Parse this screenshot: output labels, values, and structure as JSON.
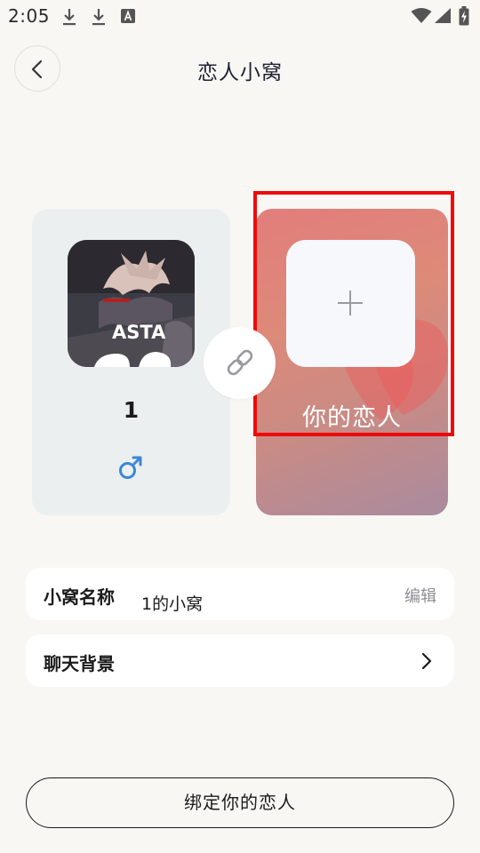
{
  "status_bar": {
    "time": "2:05",
    "icons": [
      "download-icon",
      "download-icon",
      "font-icon",
      "wifi-icon",
      "signal-icon",
      "battery-charging-icon"
    ]
  },
  "header": {
    "title": "恋人小窝",
    "back_icon": "chevron-left-icon"
  },
  "me_card": {
    "avatar_text": "ASTA",
    "name": "1",
    "gender_icon": "male-icon",
    "gender_color": "#3d86d8"
  },
  "link_icon": "link-icon",
  "lover_card": {
    "add_icon": "plus-icon",
    "label": "你的恋人"
  },
  "settings": {
    "nest_name_label": "小窝名称",
    "nest_name_value": "1的小窝",
    "edit_label": "编辑",
    "chat_bg_label": "聊天背景",
    "chat_bg_icon": "chevron-right-icon"
  },
  "bind_button": {
    "label": "绑定你的恋人"
  },
  "colors": {
    "background": "#f8f7f4",
    "highlight": "#ee0a0a",
    "lover_gradient_start": "#e27d7b",
    "lover_gradient_end": "#a98b9f"
  }
}
